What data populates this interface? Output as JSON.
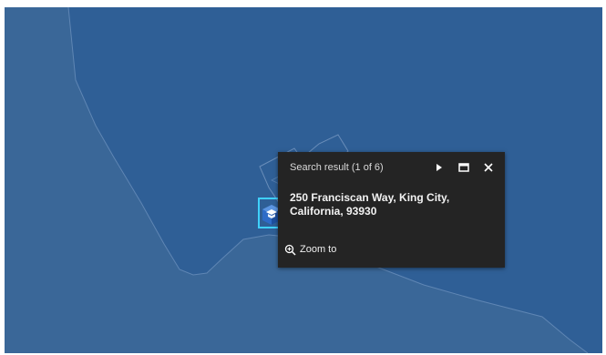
{
  "map": {
    "land_color": "#3a6798",
    "water_color": "#2f5f96",
    "boundary_color": "#6d8fb8",
    "selection_color": "#3fd0ff"
  },
  "marker": {
    "icon": "school-building-icon",
    "color": "#2e6bc7"
  },
  "popup": {
    "header": "Search result (1 of 6)",
    "title": "250 Franciscan Way, King City, California, 93930",
    "zoom_label": "Zoom to",
    "background": "#242424",
    "icons": {
      "next": "triangle-right-icon",
      "dock": "dock-icon",
      "close": "close-icon",
      "zoom": "zoom-in-icon"
    }
  }
}
